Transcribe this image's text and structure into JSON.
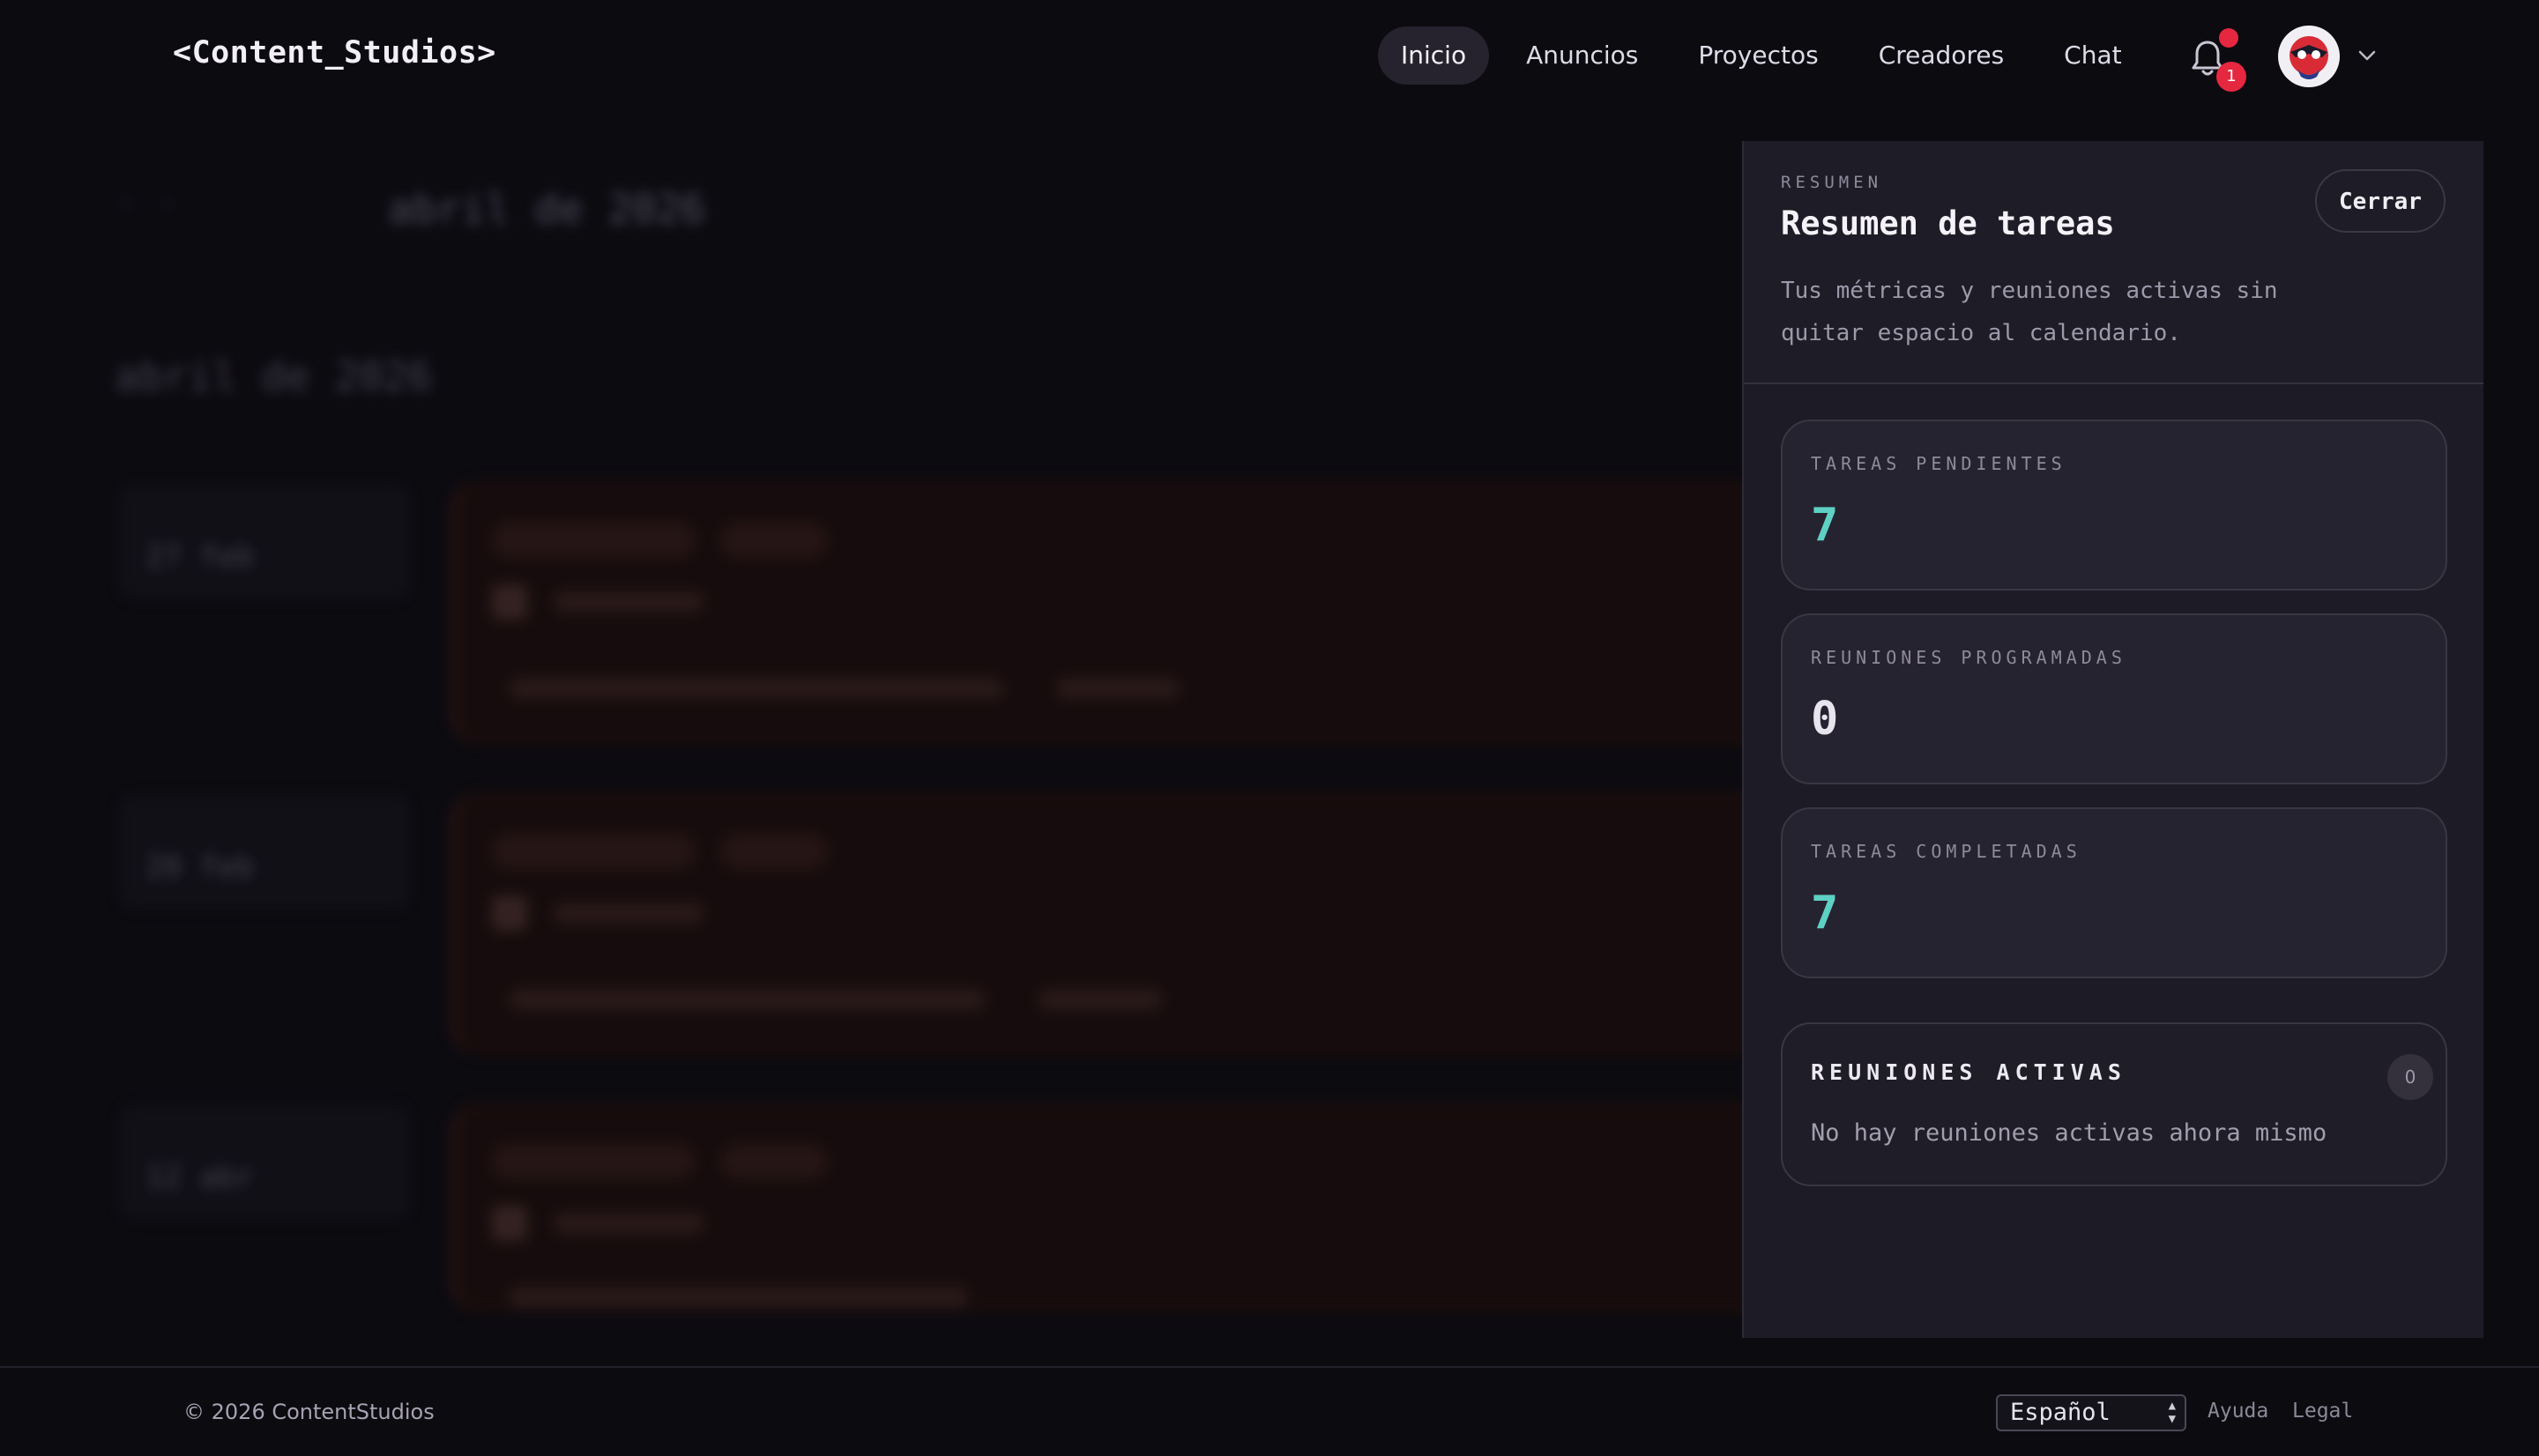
{
  "app": {
    "logo": "<Content_Studios>"
  },
  "nav": {
    "items": [
      {
        "label": "Inicio",
        "active": true
      },
      {
        "label": "Anuncios",
        "active": false
      },
      {
        "label": "Proyectos",
        "active": false
      },
      {
        "label": "Creadores",
        "active": false
      },
      {
        "label": "Chat",
        "active": false
      }
    ],
    "notifications_count": "1"
  },
  "background": {
    "month_heading": "abril de 2026",
    "section_heading": "abril de 2026",
    "dates": [
      "27 feb",
      "20 feb",
      "12 abr"
    ],
    "card_title": "Reunión"
  },
  "summary": {
    "eyebrow": "RESUMEN",
    "title": "Resumen de tareas",
    "description": "Tus métricas y reuniones activas sin quitar espacio al calendario.",
    "close_label": "Cerrar",
    "metrics": [
      {
        "label": "TAREAS PENDIENTES",
        "value": "7",
        "color": "#5ed1c4"
      },
      {
        "label": "REUNIONES PROGRAMADAS",
        "value": "0",
        "color": "#e7e4ee"
      },
      {
        "label": "TAREAS COMPLETADAS",
        "value": "7",
        "color": "#5ed1c4"
      }
    ],
    "active_meetings": {
      "title": "REUNIONES ACTIVAS",
      "count": "0",
      "empty_text": "No hay reuniones activas ahora mismo"
    }
  },
  "footer": {
    "copyright": "© 2026 ContentStudios",
    "language": "Español",
    "links": [
      "Ayuda",
      "Legal"
    ]
  },
  "colors": {
    "accent": "#5ed1c4",
    "notification": "#e5273f",
    "panel_bg": "#1d1b25"
  }
}
